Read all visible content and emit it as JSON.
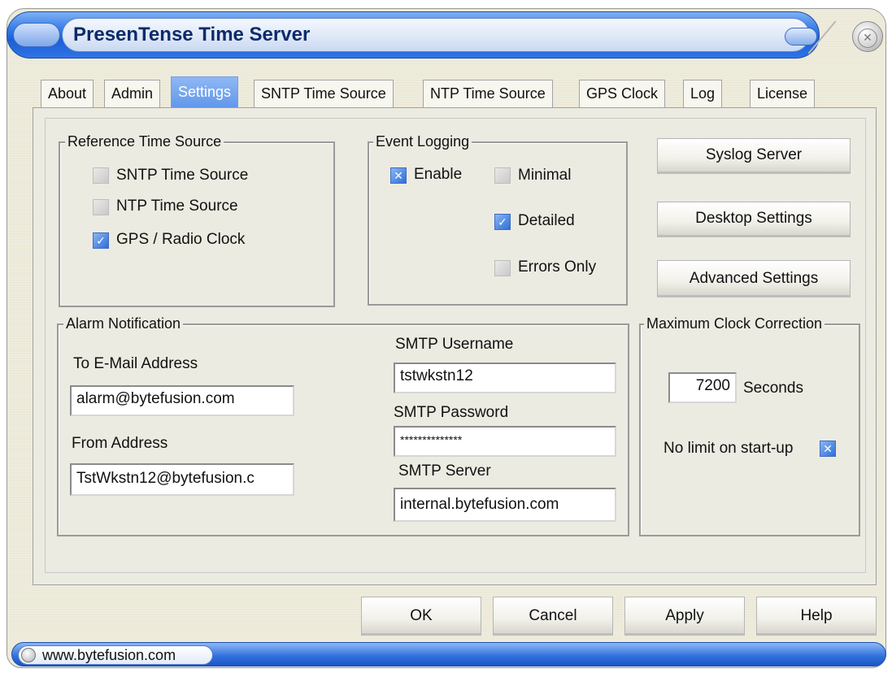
{
  "window": {
    "title": "PresenTense Time Server",
    "tabs": [
      "About",
      "Admin",
      "Settings",
      "SNTP Time Source",
      "NTP Time Source",
      "GPS Clock",
      "Log",
      "License"
    ],
    "active_tab": "Settings"
  },
  "reference_time_source": {
    "label": "Reference Time Source",
    "options": [
      {
        "label": "SNTP Time Source",
        "checked": false
      },
      {
        "label": "NTP Time Source",
        "checked": false
      },
      {
        "label": "GPS / Radio Clock",
        "checked": true
      }
    ]
  },
  "event_logging": {
    "label": "Event Logging",
    "enable": {
      "label": "Enable",
      "checked": true
    },
    "minimal": {
      "label": "Minimal",
      "checked": false
    },
    "detailed": {
      "label": "Detailed",
      "checked": true
    },
    "errors_only": {
      "label": "Errors Only",
      "checked": false
    }
  },
  "side_buttons": {
    "syslog": "Syslog Server",
    "desktop": "Desktop Settings",
    "advanced": "Advanced Settings"
  },
  "alarm_notification": {
    "label": "Alarm Notification",
    "to_label": "To E-Mail Address",
    "to_value": "alarm@bytefusion.com",
    "from_label": "From Address",
    "from_value": "TstWkstn12@bytefusion.c",
    "smtp_username_label": "SMTP Username",
    "smtp_username_value": "tstwkstn12",
    "smtp_password_label": "SMTP Password",
    "smtp_password_value": "**************",
    "smtp_server_label": "SMTP Server",
    "smtp_server_value": "internal.bytefusion.com"
  },
  "max_clock_correction": {
    "label": "Maximum Clock Correction",
    "value": "7200",
    "unit": "Seconds",
    "no_limit_label": "No limit on start-up",
    "no_limit_checked": true
  },
  "footer_buttons": {
    "ok": "OK",
    "cancel": "Cancel",
    "apply": "Apply",
    "help": "Help"
  },
  "status": {
    "url": "www.bytefusion.com"
  },
  "colors": {
    "accent": "#2e6fd9",
    "title_text": "#0b2b6b",
    "panel_bg": "#ecebe2"
  }
}
